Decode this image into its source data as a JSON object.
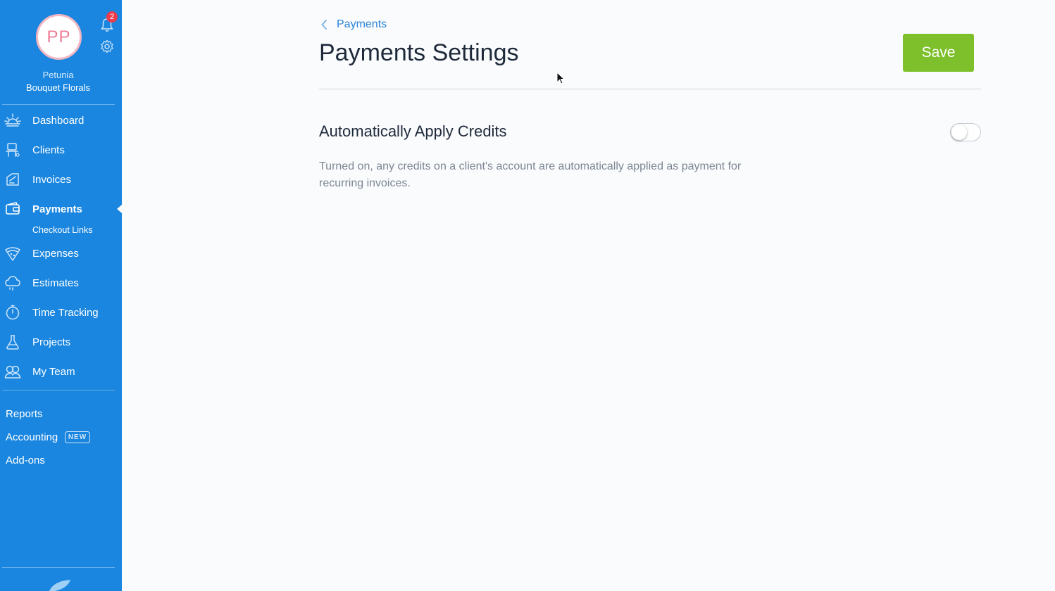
{
  "user": {
    "initials": "PP",
    "first_name": "Petunia",
    "company": "Bouquet Florals"
  },
  "notifications": {
    "count": "2"
  },
  "nav": {
    "items": [
      {
        "label": "Dashboard",
        "icon": "sunrise-icon"
      },
      {
        "label": "Clients",
        "icon": "clients-icon"
      },
      {
        "label": "Invoices",
        "icon": "invoice-icon"
      },
      {
        "label": "Payments",
        "icon": "wallet-icon",
        "active": true
      },
      {
        "label": "Expenses",
        "icon": "expenses-icon"
      },
      {
        "label": "Estimates",
        "icon": "cloud-icon"
      },
      {
        "label": "Time Tracking",
        "icon": "stopwatch-icon"
      },
      {
        "label": "Projects",
        "icon": "flask-icon"
      },
      {
        "label": "My Team",
        "icon": "team-icon"
      }
    ],
    "sub_item": "Checkout Links",
    "bottom_links": [
      "Reports",
      "Accounting",
      "Add-ons"
    ],
    "new_badge": "NEW"
  },
  "header": {
    "breadcrumb": "Payments",
    "title": "Payments Settings",
    "save_label": "Save"
  },
  "setting": {
    "title": "Automatically Apply Credits",
    "description": "Turned on, any credits on a client's account are automatically applied as payment for recurring invoices.",
    "enabled": false
  },
  "colors": {
    "sidebar": "#1a86df",
    "save": "#7dc02b",
    "link": "#2a84d8"
  }
}
